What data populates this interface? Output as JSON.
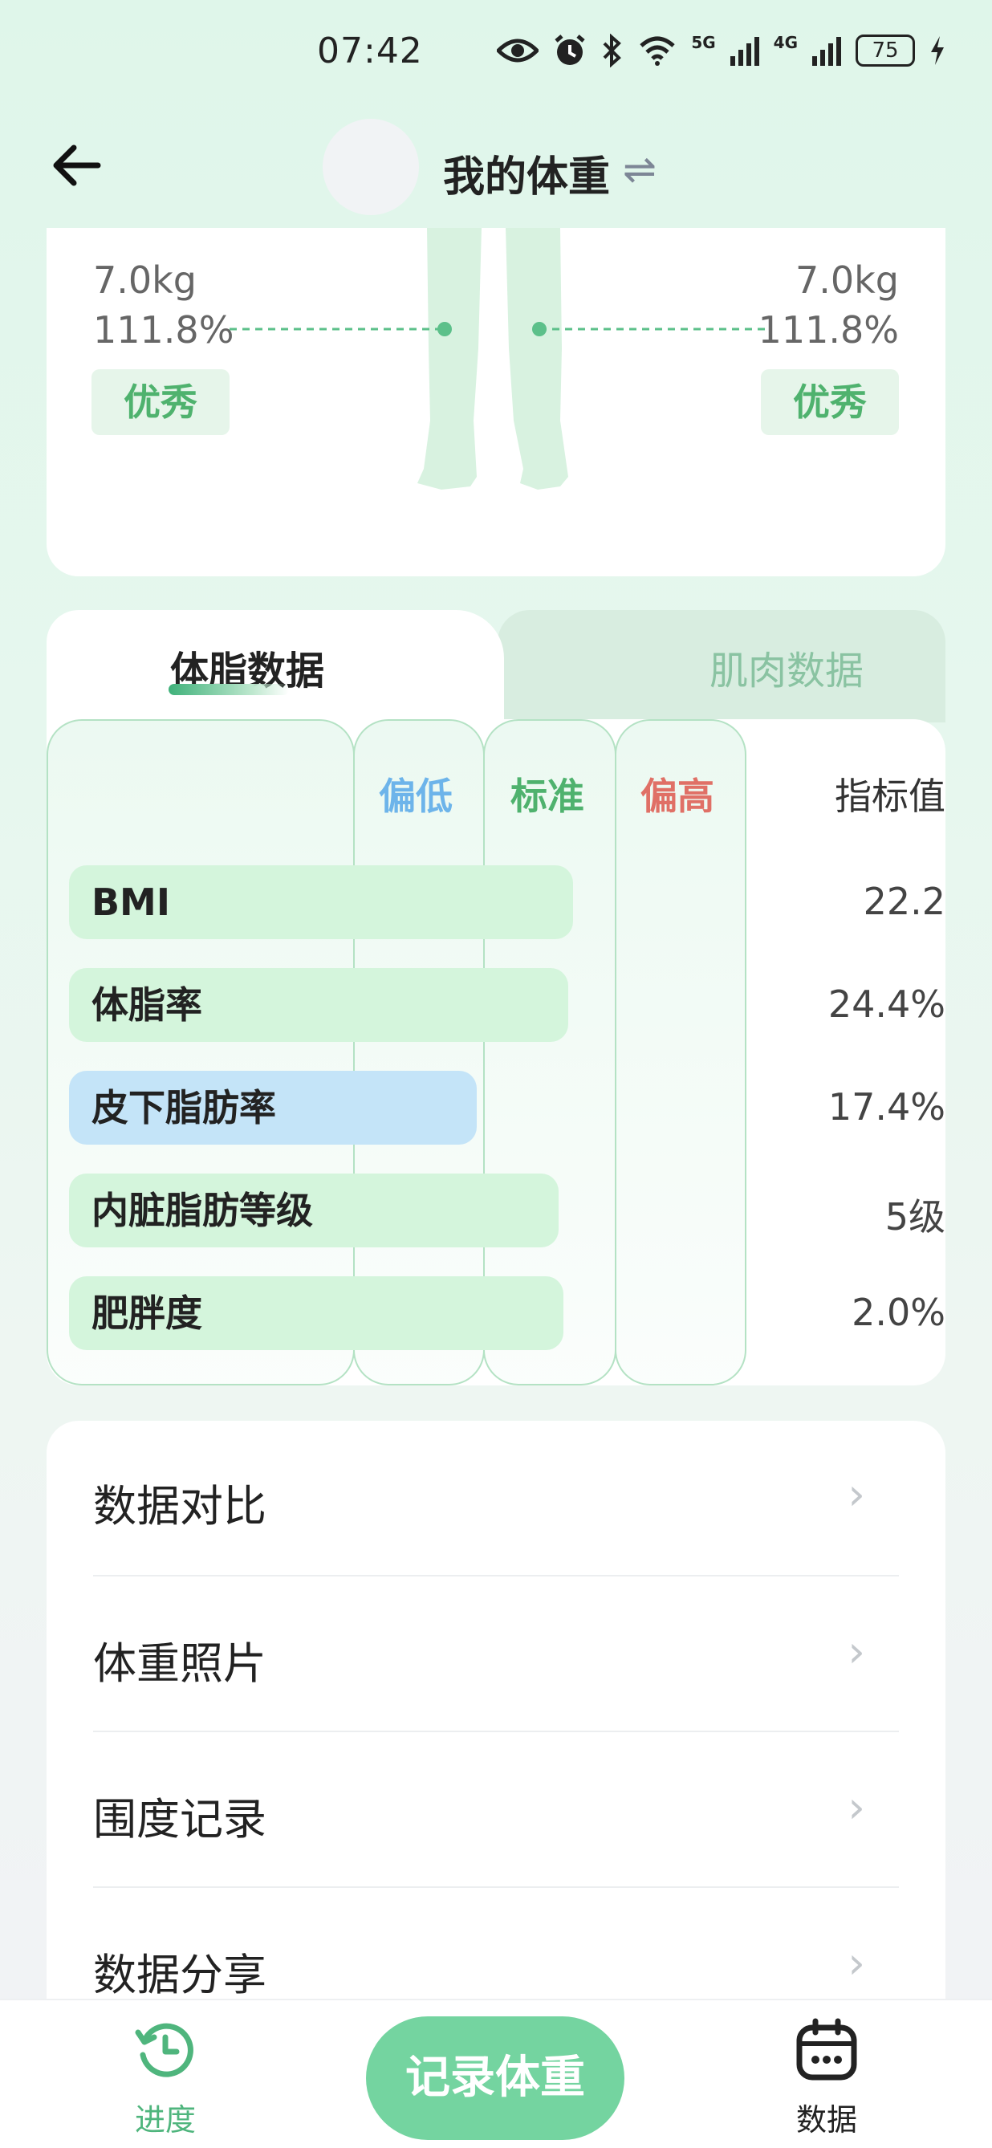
{
  "status_bar": {
    "time": "07:42",
    "net1": "5G",
    "net2": "4G",
    "battery": "75",
    "icons": [
      "eye-icon",
      "alarm-icon",
      "bluetooth-icon",
      "wifi-icon",
      "signal-icon",
      "battery-icon",
      "charging-icon"
    ]
  },
  "header": {
    "title": "我的体重",
    "back_icon": "arrow-left-icon",
    "swap_icon": "swap-icon",
    "swap_glyph": "⇌"
  },
  "body_diagram": {
    "left": {
      "weight": "7.0kg",
      "percent": "111.8%",
      "rating": "优秀"
    },
    "right": {
      "weight": "7.0kg",
      "percent": "111.8%",
      "rating": "优秀"
    }
  },
  "tabs": [
    {
      "label": "体脂数据",
      "active": true
    },
    {
      "label": "肌肉数据",
      "active": false
    }
  ],
  "fat_table": {
    "headers": {
      "low": "偏低",
      "standard": "标准",
      "high": "偏高",
      "value": "指标值"
    },
    "header_colors": {
      "low": "#6db4ea",
      "standard": "#4fb26e",
      "high": "#e07066",
      "value": "#333333"
    },
    "rows": [
      {
        "name": "BMI",
        "value": "22.2",
        "level": "standard",
        "color": "#d4f5dc"
      },
      {
        "name": "体脂率",
        "value": "24.4%",
        "level": "standard",
        "color": "#d4f5dc"
      },
      {
        "name": "皮下脂肪率",
        "value": "17.4%",
        "level": "low",
        "color": "#c4e4f8"
      },
      {
        "name": "内脏脂肪等级",
        "value": "5级",
        "level": "standard",
        "color": "#d4f5dc"
      },
      {
        "name": "肥胖度",
        "value": "2.0%",
        "level": "standard",
        "color": "#d4f5dc"
      }
    ]
  },
  "menu": {
    "items": [
      {
        "label": "数据对比",
        "icon": "chevron-right-icon"
      },
      {
        "label": "体重照片",
        "icon": "chevron-right-icon"
      },
      {
        "label": "围度记录",
        "icon": "chevron-right-icon"
      },
      {
        "label": "数据分享",
        "icon": "chevron-right-icon"
      }
    ],
    "chevron_glyph": "›"
  },
  "bottom_nav": {
    "progress_label": "进度",
    "progress_icon": "clock-refresh-icon",
    "record_label": "记录体重",
    "data_label": "数据",
    "data_icon": "calendar-icon"
  }
}
